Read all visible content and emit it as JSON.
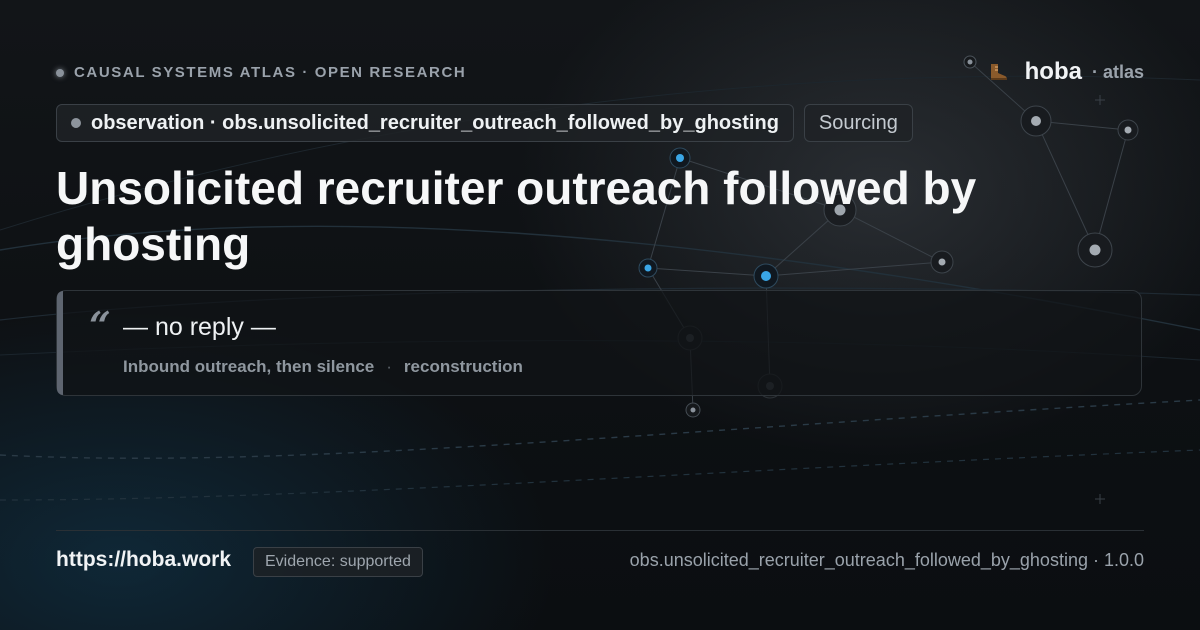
{
  "header": {
    "kicker": "CAUSAL SYSTEMS ATLAS · OPEN RESEARCH",
    "brand_name": "hoba",
    "brand_sub": "· atlas"
  },
  "chips": {
    "identifier": "observation · obs.unsolicited_recruiter_outreach_followed_by_ghosting",
    "stage": "Sourcing"
  },
  "title": "Unsolicited recruiter outreach followed by ghosting",
  "quote": {
    "mark": "“",
    "text": "— no reply —",
    "caption": "Inbound outreach, then silence",
    "separator": "·",
    "source": "reconstruction"
  },
  "footer": {
    "url": "https://hoba.work",
    "evidence": "Evidence: supported",
    "version_line": "obs.unsolicited_recruiter_outreach_followed_by_ghosting · 1.0.0"
  },
  "colors": {
    "background": "#0e1114",
    "accent_node": "#3aa6e6",
    "text_primary": "#f6f7f8",
    "text_muted": "#9aa2ab"
  },
  "icons": {
    "brand_logo": "boot-icon"
  }
}
